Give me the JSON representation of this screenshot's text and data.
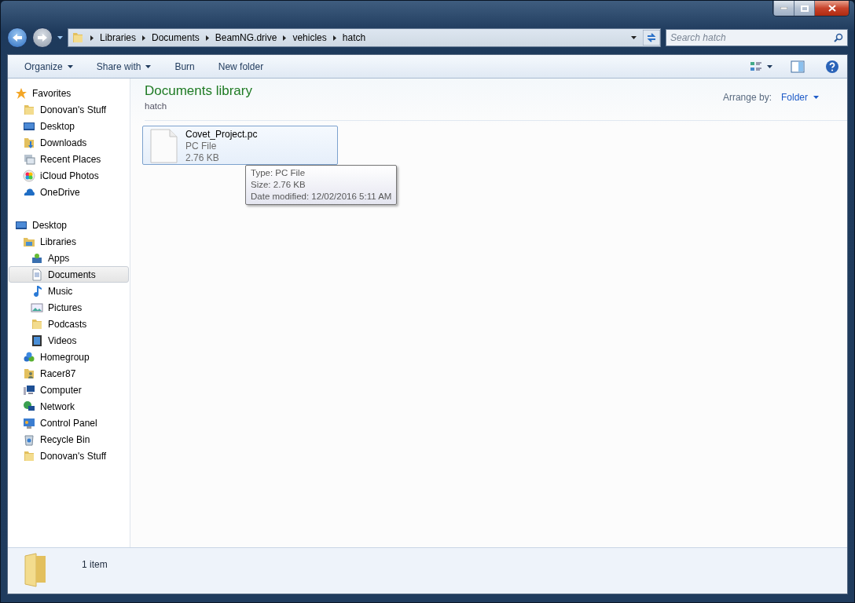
{
  "breadcrumb": [
    "Libraries",
    "Documents",
    "BeamNG.drive",
    "vehicles",
    "hatch"
  ],
  "search": {
    "placeholder": "Search hatch"
  },
  "toolbar": {
    "buttons": [
      {
        "label": "Organize",
        "dropdown": true
      },
      {
        "label": "Share with",
        "dropdown": true
      },
      {
        "label": "Burn",
        "dropdown": false
      },
      {
        "label": "New folder",
        "dropdown": false
      }
    ]
  },
  "sidebar": {
    "groups": [
      {
        "label": "Favorites",
        "kind": "star",
        "selected": false,
        "children": [
          {
            "label": "Donovan's Stuff",
            "kind": "folder",
            "selected": false
          },
          {
            "label": "Desktop",
            "kind": "desktop",
            "selected": false
          },
          {
            "label": "Downloads",
            "kind": "downloads",
            "selected": false
          },
          {
            "label": "Recent Places",
            "kind": "recent",
            "selected": false
          },
          {
            "label": "iCloud Photos",
            "kind": "photos",
            "selected": false
          },
          {
            "label": "OneDrive",
            "kind": "cloud",
            "selected": false
          }
        ]
      },
      {
        "label": "Desktop",
        "kind": "desktop",
        "selected": false,
        "children": [
          {
            "label": "Libraries",
            "kind": "library",
            "selected": false,
            "children": [
              {
                "label": "Apps",
                "kind": "apps",
                "selected": false
              },
              {
                "label": "Documents",
                "kind": "document",
                "selected": true
              },
              {
                "label": "Music",
                "kind": "music",
                "selected": false
              },
              {
                "label": "Pictures",
                "kind": "picture",
                "selected": false
              },
              {
                "label": "Podcasts",
                "kind": "folder",
                "selected": false
              },
              {
                "label": "Videos",
                "kind": "video",
                "selected": false
              }
            ]
          },
          {
            "label": "Homegroup",
            "kind": "homegroup",
            "selected": false
          },
          {
            "label": "Racer87",
            "kind": "user",
            "selected": false
          },
          {
            "label": "Computer",
            "kind": "computer",
            "selected": false
          },
          {
            "label": "Network",
            "kind": "network",
            "selected": false
          },
          {
            "label": "Control Panel",
            "kind": "control",
            "selected": false
          },
          {
            "label": "Recycle Bin",
            "kind": "recycle",
            "selected": false
          },
          {
            "label": "Donovan's Stuff",
            "kind": "folder",
            "selected": false
          }
        ]
      }
    ]
  },
  "library": {
    "title": "Documents library",
    "subtitle": "hatch",
    "arrange_label": "Arrange by:",
    "arrange_value": "Folder"
  },
  "files": [
    {
      "name": "Covet_Project.pc",
      "type": "PC File",
      "size": "2.76 KB",
      "selected": true
    }
  ],
  "tooltip": {
    "lines": [
      "Type: PC File",
      "Size: 2.76 KB",
      "Date modified: 12/02/2016 5:11 AM"
    ]
  },
  "status_bar": {
    "count": "1 item"
  }
}
